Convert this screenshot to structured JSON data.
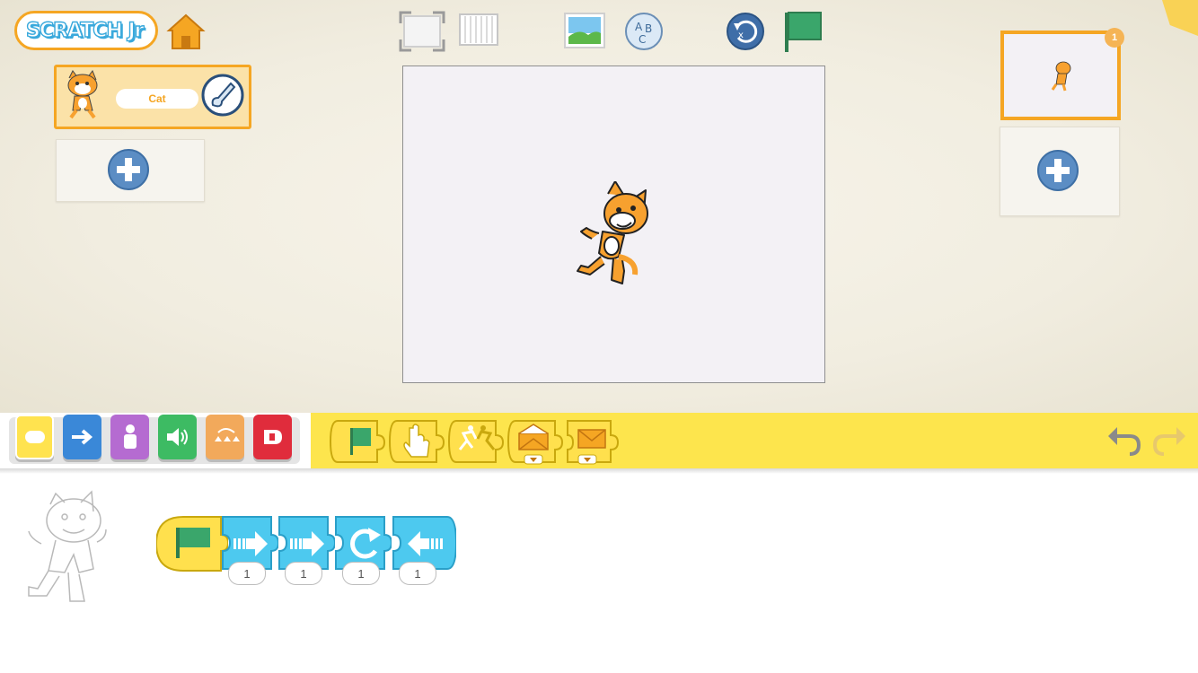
{
  "app": {
    "logo_text": "SCRATCH Jr",
    "colors": {
      "accent_orange": "#f5a623",
      "palette_yellow": "#fde54d",
      "motion_blue": "#3a88d8",
      "looks_purple": "#b56bd1",
      "sound_green": "#3dbb63",
      "control_orange": "#f2a95b",
      "end_red": "#e02c3c",
      "trigger_yellow": "#ffe04d",
      "script_blue": "#4dc9ef"
    }
  },
  "toolbar": {
    "home_icon": "home-icon",
    "fullscreen_icon": "fullscreen-icon",
    "grid_icon": "grid-icon",
    "background_icon": "background-icon",
    "text_icon": "text-icon",
    "reset_icon": "reset-icon",
    "green_flag_icon": "green-flag-icon"
  },
  "sprites": {
    "items": [
      {
        "name": "Cat",
        "selected": true
      }
    ],
    "add_icon": "plus-icon"
  },
  "pages": {
    "items": [
      {
        "number": "1",
        "selected": true
      }
    ],
    "add_icon": "plus-icon"
  },
  "palette": {
    "categories": [
      {
        "name": "triggering",
        "selected": true
      },
      {
        "name": "motion"
      },
      {
        "name": "looks"
      },
      {
        "name": "sound"
      },
      {
        "name": "control"
      },
      {
        "name": "end"
      }
    ],
    "blocks": [
      "start-on-green-flag",
      "start-on-tap",
      "start-on-bump",
      "start-on-message",
      "send-message"
    ],
    "undo_icon": "undo-icon",
    "redo_icon": "redo-icon"
  },
  "script": {
    "blocks": [
      {
        "type": "start-on-green-flag"
      },
      {
        "type": "move-right",
        "param": "1"
      },
      {
        "type": "move-right",
        "param": "1"
      },
      {
        "type": "turn-right",
        "param": "1"
      },
      {
        "type": "move-left",
        "param": "1"
      }
    ]
  }
}
